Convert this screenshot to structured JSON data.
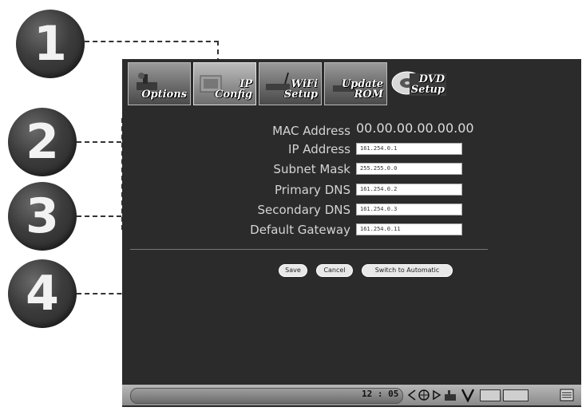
{
  "callouts": [
    "1",
    "2",
    "3",
    "4"
  ],
  "tabs": [
    {
      "label": "Options",
      "icon": "options-icon"
    },
    {
      "label": "IP\nConfig",
      "icon": "ip-config-icon"
    },
    {
      "label": "WiFi\nSetup",
      "icon": "wifi-setup-icon"
    },
    {
      "label": "Update\nROM",
      "icon": "update-rom-icon"
    },
    {
      "label": "DVD\nSetup",
      "icon": "dvd-disc-icon"
    }
  ],
  "network": {
    "mac_label": "MAC Address",
    "mac_value": "00.00.00.00.00.00",
    "ip_label": "IP Address",
    "ip_value": "161.254.0.1",
    "subnet_label": "Subnet Mask",
    "subnet_value": "255.255.0.0",
    "dns1_label": "Primary DNS",
    "dns1_value": "161.254.0.2",
    "dns2_label": "Secondary DNS",
    "dns2_value": "161.254.0.3",
    "gateway_label": "Default Gateway",
    "gateway_value": "161.254.0.11"
  },
  "buttons": {
    "save": "Save",
    "cancel": "Cancel",
    "switch": "Switch to Automatic"
  },
  "status": {
    "time": "12 : 05",
    "icons": [
      "rewind-icon",
      "navigation-icon",
      "play-icon",
      "audio-icon",
      "network-icon",
      "screen-mode-icon",
      "display-mode-icon",
      "menu-icon"
    ]
  }
}
